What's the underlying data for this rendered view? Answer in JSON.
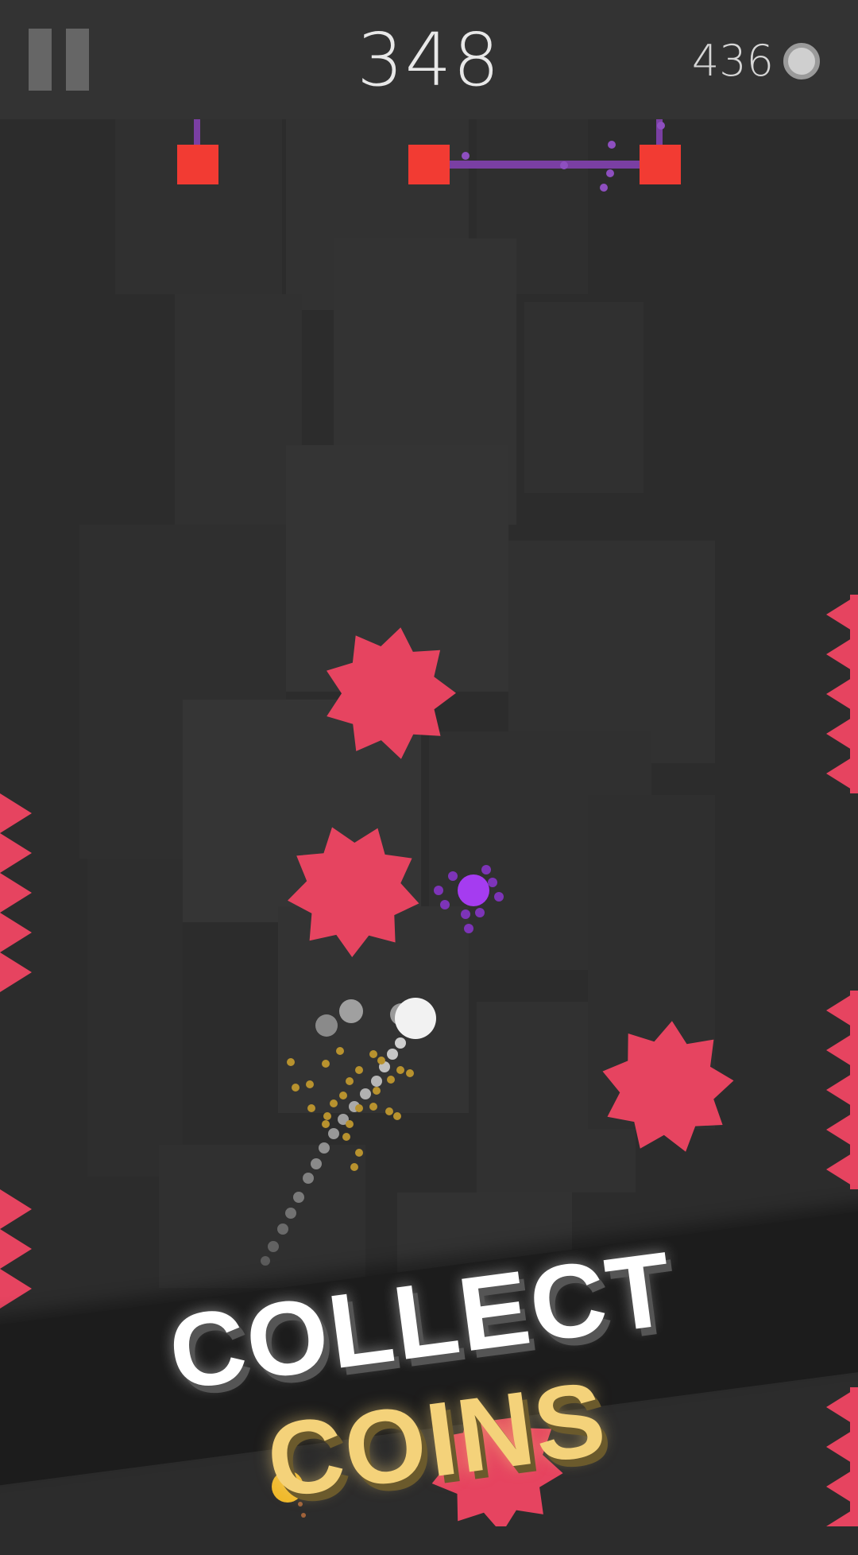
{
  "hud": {
    "score": "348",
    "coins": "436",
    "pause_icon": "pause-icon",
    "coin_icon": "coin-icon"
  },
  "banner": {
    "word1": "COLLECT",
    "word2": "COINS"
  },
  "colors": {
    "background": "#2c2c2c",
    "hud_bar": "#333333",
    "hazard_pink": "#e64460",
    "block_red": "#f23b33",
    "laser_purple": "#7a3fa3",
    "enemy_purple": "#a53cf0",
    "player_white": "#f2f2f2",
    "coin_gold": "#f0b92a",
    "banner_gold_text": "#f4d27a"
  }
}
